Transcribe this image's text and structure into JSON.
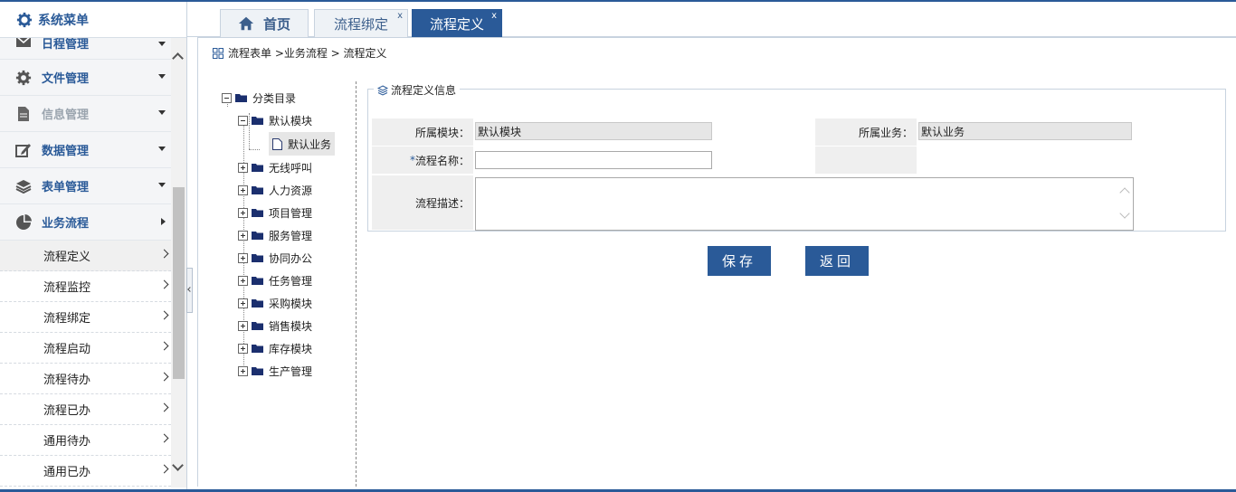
{
  "sidebar": {
    "title": "系统菜单",
    "menu": [
      {
        "label": "日程管理",
        "icon": "mail-icon"
      },
      {
        "label": "文件管理",
        "icon": "gear-icon"
      },
      {
        "label": "信息管理",
        "icon": "document-icon"
      },
      {
        "label": "数据管理",
        "icon": "edit-icon"
      },
      {
        "label": "表单管理",
        "icon": "layers-icon"
      },
      {
        "label": "业务流程",
        "icon": "pie-chart-icon"
      }
    ],
    "sub_items": [
      {
        "label": "流程定义"
      },
      {
        "label": "流程监控"
      },
      {
        "label": "流程绑定"
      },
      {
        "label": "流程启动"
      },
      {
        "label": "流程待办"
      },
      {
        "label": "流程已办"
      },
      {
        "label": "通用待办"
      },
      {
        "label": "通用已办"
      }
    ]
  },
  "tabs": [
    {
      "label": "首页"
    },
    {
      "label": "流程绑定",
      "close": "x"
    },
    {
      "label": "流程定义",
      "close": "x"
    }
  ],
  "breadcrumb": "流程表单 >业务流程 > 流程定义",
  "tree": {
    "root": "分类目录",
    "expanded": "默认模块",
    "selected_leaf": "默认业务",
    "folders": [
      "无线呼叫",
      "人力资源",
      "项目管理",
      "服务管理",
      "协同办公",
      "任务管理",
      "采购模块",
      "销售模块",
      "库存模块",
      "生产管理"
    ]
  },
  "form": {
    "legend": "流程定义信息",
    "module_label": "所属模块：",
    "module_value": "默认模块",
    "business_label": "所属业务：",
    "business_value": "默认业务",
    "name_required": "*",
    "name_label": "流程名称：",
    "name_value": "",
    "desc_label": "流程描述：",
    "desc_value": ""
  },
  "buttons": {
    "save": "保存",
    "back": "返回"
  }
}
